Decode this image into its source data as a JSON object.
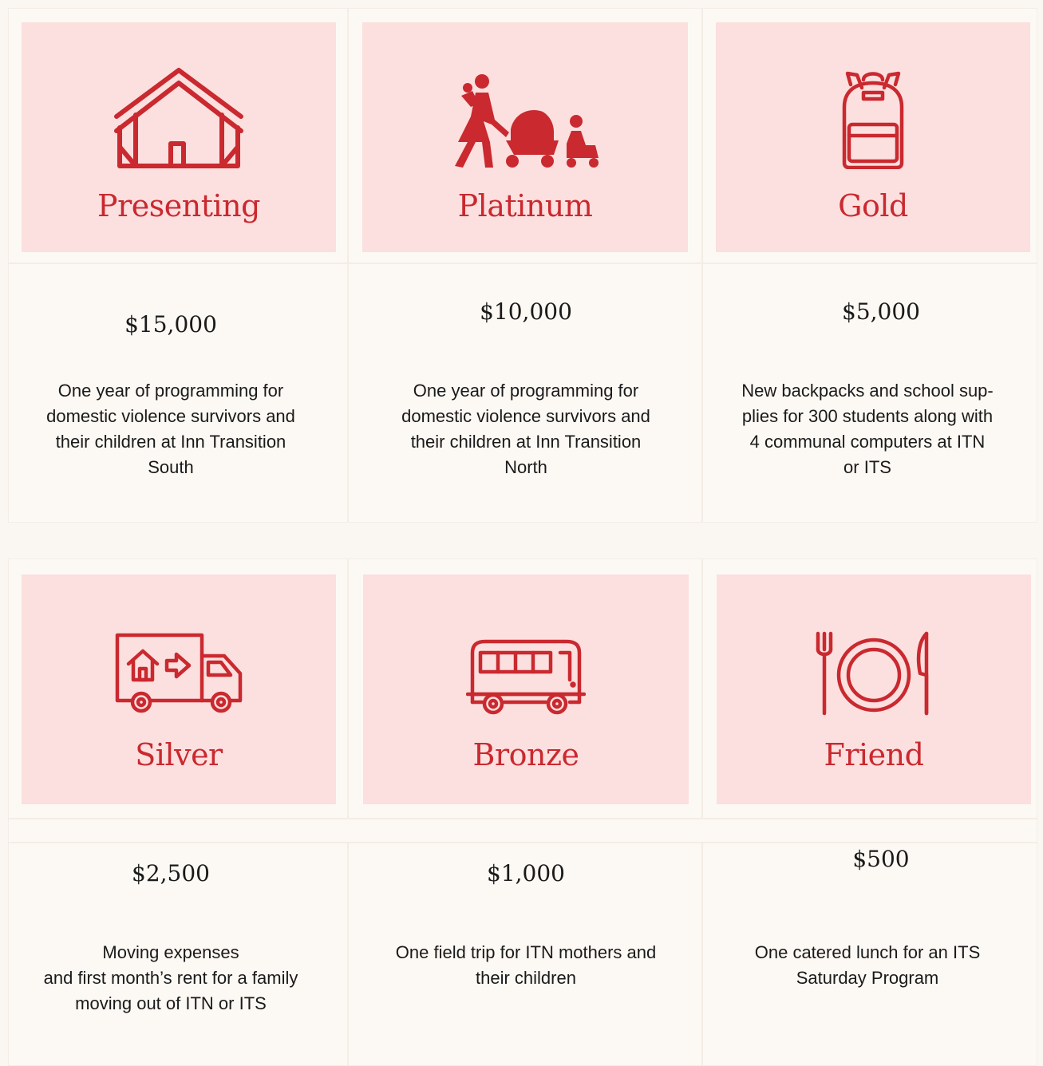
{
  "tiers": [
    {
      "title": "Presenting",
      "icon": "house-icon",
      "price": "$15,000",
      "description": "One year of programming for\ndomestic violence survivors and\ntheir children at Inn Transition\nSouth"
    },
    {
      "title": "Platinum",
      "icon": "family-stroller-icon",
      "price": "$10,000",
      "description": "One year of programming for\ndomestic violence survivors and\ntheir children at Inn Transition\nNorth"
    },
    {
      "title": "Gold",
      "icon": "backpack-icon",
      "price": "$5,000",
      "description": "New backpacks and school sup-\nplies for 300 students along with\n4 communal computers at ITN\nor ITS"
    },
    {
      "title": "Silver",
      "icon": "moving-truck-icon",
      "price": "$2,500",
      "description": "Moving expenses\nand first month’s rent for a family\nmoving out of ITN or ITS"
    },
    {
      "title": "Bronze",
      "icon": "bus-icon",
      "price": "$1,000",
      "description": "One field trip for ITN mothers and\ntheir children"
    },
    {
      "title": "Friend",
      "icon": "plate-fork-knife-icon",
      "price": "$500",
      "description": "One catered lunch for an ITS\nSaturday Program"
    }
  ],
  "colors": {
    "accent": "#c9292f",
    "card_bg": "#fcdfdf",
    "page_bg": "#faf7f2",
    "text": "#1a1a1a"
  }
}
